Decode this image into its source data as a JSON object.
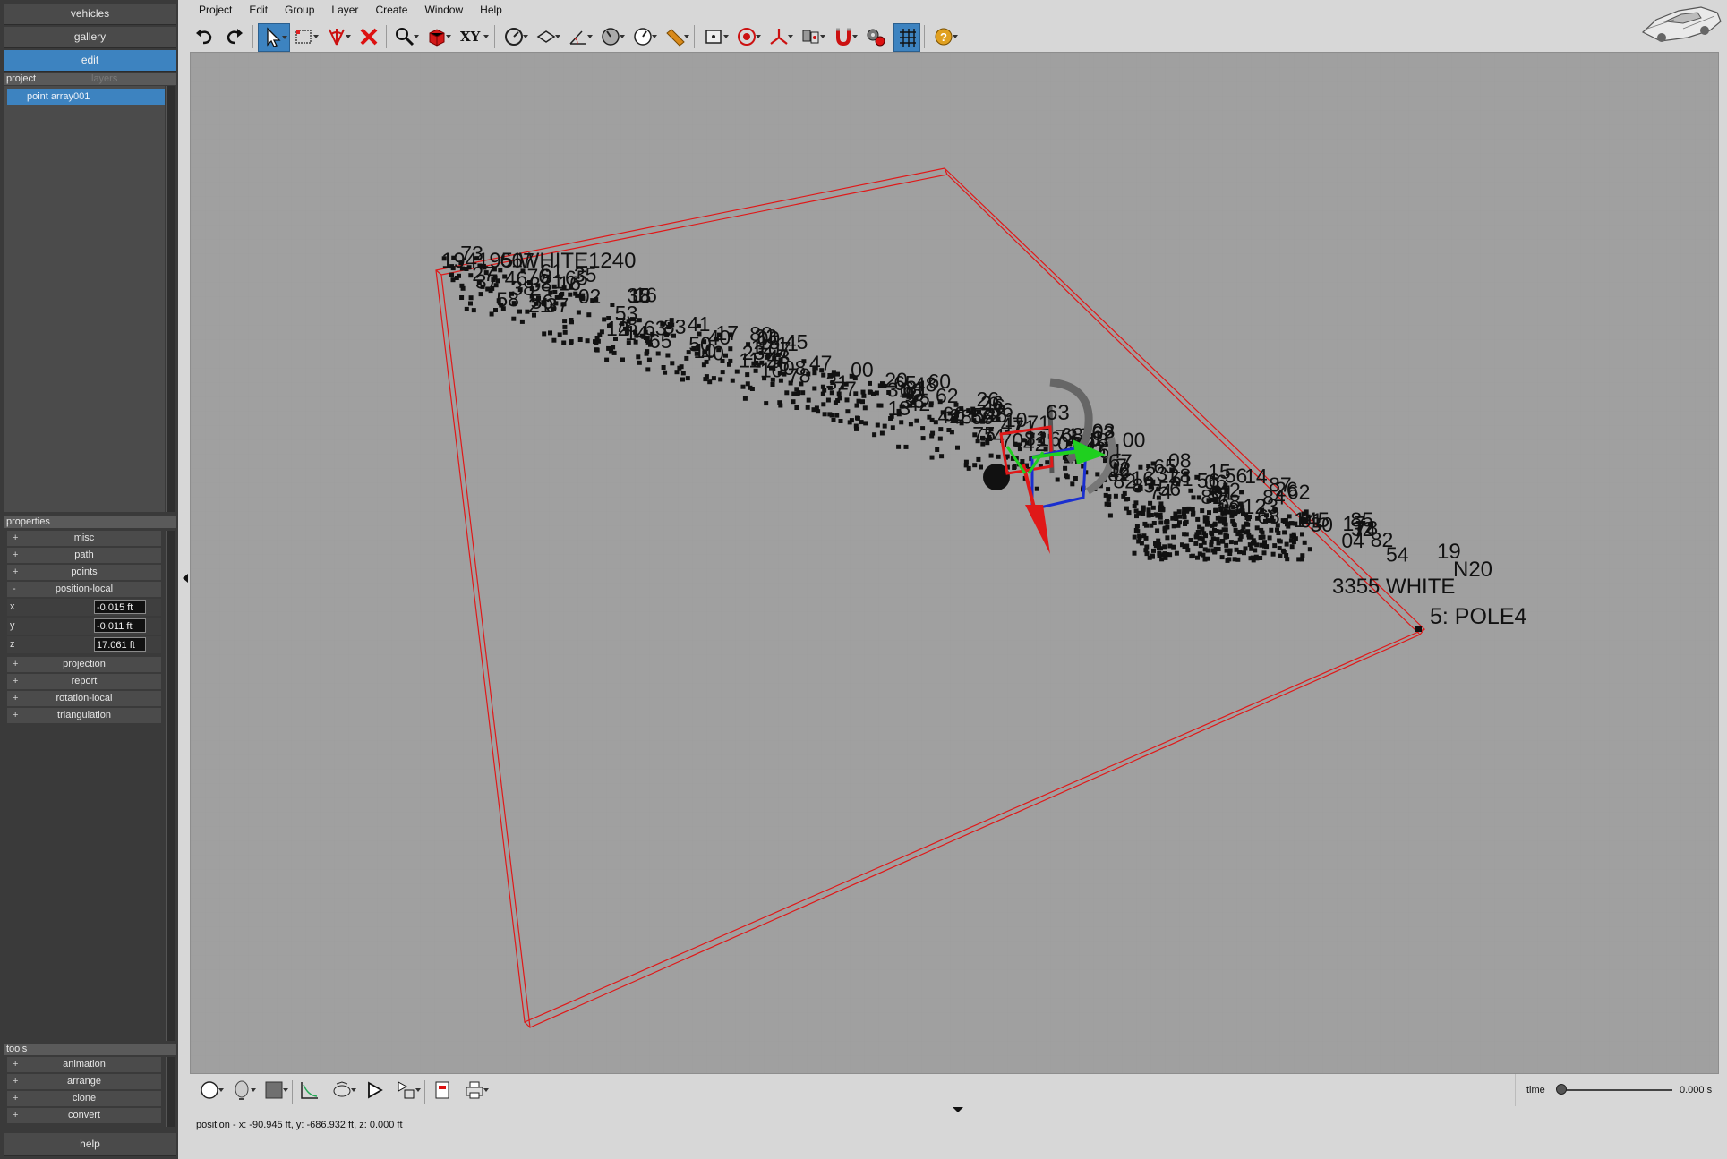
{
  "nav": {
    "vehicles": "vehicles",
    "gallery": "gallery",
    "edit": "edit"
  },
  "project_panel": {
    "tabs": [
      "project",
      "layers"
    ],
    "tree_items": [
      "point array001"
    ]
  },
  "properties": {
    "header": "properties",
    "groups_before": [
      {
        "sign": "+",
        "label": "misc"
      },
      {
        "sign": "+",
        "label": "path"
      },
      {
        "sign": "+",
        "label": "points"
      },
      {
        "sign": "-",
        "label": "position-local"
      }
    ],
    "fields": [
      {
        "label": "x",
        "value": "-0.015 ft"
      },
      {
        "label": "y",
        "value": "-0.011 ft"
      },
      {
        "label": "z",
        "value": "17.061 ft"
      }
    ],
    "groups_after": [
      {
        "sign": "+",
        "label": "projection"
      },
      {
        "sign": "+",
        "label": "report"
      },
      {
        "sign": "+",
        "label": "rotation-local"
      },
      {
        "sign": "+",
        "label": "triangulation"
      }
    ]
  },
  "tools": {
    "header": "tools",
    "items": [
      {
        "sign": "+",
        "label": "animation"
      },
      {
        "sign": "+",
        "label": "arrange"
      },
      {
        "sign": "+",
        "label": "clone"
      },
      {
        "sign": "+",
        "label": "convert"
      }
    ]
  },
  "help_label": "help",
  "menu": [
    "Project",
    "Edit",
    "Group",
    "Layer",
    "Create",
    "Window",
    "Help"
  ],
  "toolbar": {
    "view_label": "XY"
  },
  "viewport": {
    "labels": {
      "pole": "5: POLE4",
      "top_cluster": "194195 WHITE1240",
      "right_a": "N20",
      "right_b": "19",
      "right_c": "3355 WHITE",
      "mid_a": "63",
      "mid_b": "67",
      "mid_c": "123",
      "mid_d": "145"
    },
    "colors": {
      "background": "#a0a0a0",
      "box": "#e01818",
      "axis_x": "#e01818",
      "axis_y": "#1fd01f",
      "axis_z": "#1a2fcf"
    }
  },
  "status": {
    "position": "position - x: -90.945 ft, y: -686.932 ft, z: 0.000 ft"
  },
  "time": {
    "label": "time",
    "value": "0.000 s"
  }
}
